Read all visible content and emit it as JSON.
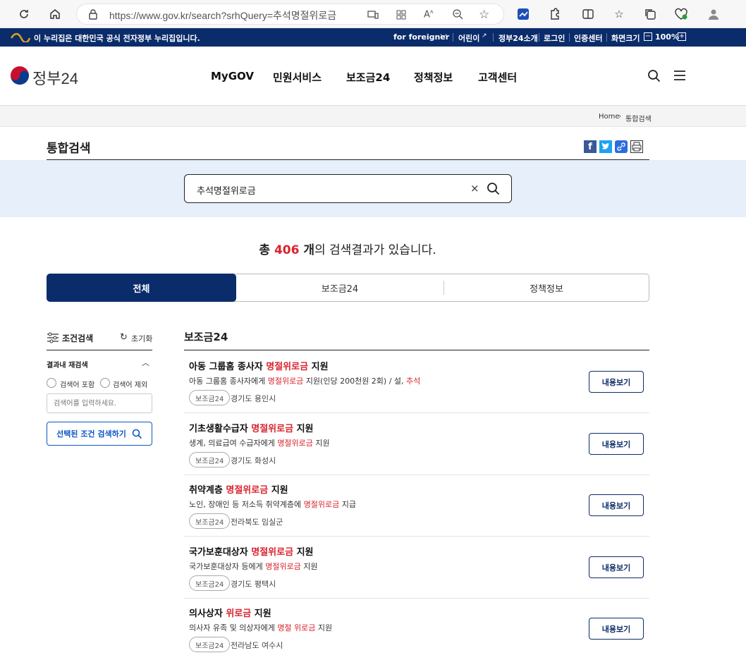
{
  "browser": {
    "url": "https://www.gov.kr/search?srhQuery=추석명절위로금"
  },
  "banner": {
    "notice": "이 누리집은 대한민국 공식 전자정부 누리집입니다.",
    "links": [
      "for foreigner",
      "어린이",
      "정부24소개",
      "로그인",
      "인증센터",
      "화면크기"
    ],
    "zoom": "100%"
  },
  "header": {
    "logo": "정부24",
    "nav": [
      "MyGOV",
      "민원서비스",
      "보조금24",
      "정책정보",
      "고객센터"
    ]
  },
  "breadcrumb": {
    "home": "Home",
    "current": "통합검색"
  },
  "page": {
    "title": "통합검색"
  },
  "search": {
    "query": "추석명절위로금"
  },
  "summary": {
    "prefix": "총 ",
    "count": "406",
    "unit": " 개",
    "suffix": "의 검색결과가 있습니다."
  },
  "tabs": [
    "전체",
    "보조금24",
    "정책정보"
  ],
  "filter": {
    "title": "조건검색",
    "reset": "초기화",
    "section": "결과내 재검색",
    "include": "검색어 포함",
    "exclude": "검색어 제외",
    "placeholder": "검색어를 입력하세요.",
    "submit": "선택된 조건 검색하기"
  },
  "results": {
    "section_title": "보조금24",
    "view_label": "내용보기",
    "items": [
      {
        "title_pre": "아동 그룹홈 종사자 ",
        "title_hl": "명절위로금",
        "title_post": " 지원",
        "desc_pre": "아동 그룹홈 종사자에게 ",
        "desc_hl": "명절위로금",
        "desc_post": " 지원(인당 200천원 2회) / 설, ",
        "desc_hl2": "추석",
        "tag": "보조금24",
        "region": "경기도 용인시"
      },
      {
        "title_pre": "기초생활수급자 ",
        "title_hl": "명절위로금",
        "title_post": " 지원",
        "desc_pre": "생계, 의료급여 수급자에게 ",
        "desc_hl": "명절위로금",
        "desc_post": " 지원",
        "desc_hl2": "",
        "tag": "보조금24",
        "region": "경기도 화성시"
      },
      {
        "title_pre": "취약계층 ",
        "title_hl": "명절위로금",
        "title_post": " 지원",
        "desc_pre": "노인, 장애인 등 저소득 취약계층에 ",
        "desc_hl": "명절위로금",
        "desc_post": " 지급",
        "desc_hl2": "",
        "tag": "보조금24",
        "region": "전라북도 임실군"
      },
      {
        "title_pre": "국가보훈대상자 ",
        "title_hl": "명절위로금",
        "title_post": " 지원",
        "desc_pre": "국가보훈대상자 등에게 ",
        "desc_hl": "명절위로금",
        "desc_post": " 지원",
        "desc_hl2": "",
        "tag": "보조금24",
        "region": "경기도 평택시"
      },
      {
        "title_pre": "의사상자 ",
        "title_hl": "위로금",
        "title_post": " 지원",
        "desc_pre": "의사자 유족 및 의상자에게 ",
        "desc_hl": "명절 위로금",
        "desc_post": " 지원",
        "desc_hl2": "",
        "tag": "보조금24",
        "region": "전라남도 여수시"
      }
    ]
  },
  "colors": {
    "primary": "#0b2c6a",
    "highlight": "#d9232d",
    "band": "#e6effa"
  }
}
